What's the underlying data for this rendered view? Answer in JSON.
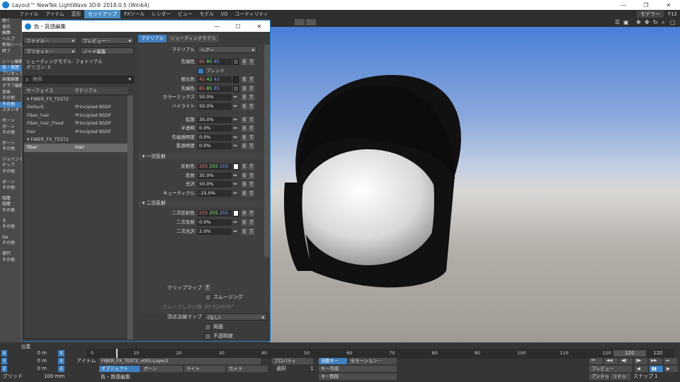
{
  "app": {
    "title": "Layout™ NewTek LightWave 3D® 2018.0.5 (Win64)",
    "win_min": "—",
    "win_max": "❐",
    "win_close": "✕"
  },
  "menu": {
    "tabs": [
      "ファイル",
      "アイテム",
      "変形",
      "セットアップ",
      "FXツール",
      "レンダー",
      "ビュー",
      "モデル",
      "I/O",
      "ユーティリティ"
    ],
    "active": "セットアップ",
    "modeler_btn": "モデラー",
    "f12": "F12"
  },
  "left_sidebar": [
    "開く",
    "保存",
    "編集",
    "ヘルプ",
    "新規シーン",
    "終了",
    "",
    "シーン編集",
    "色・質感",
    "プリセット",
    "画像編集",
    "グラフ編集",
    "背景",
    "その他",
    "その他",
    "スタジオ",
    "",
    "ボーン",
    "ボーン",
    "その他",
    "",
    "ボーン",
    "その他",
    "",
    "ジョイント",
    "チップ",
    "その他",
    "",
    "ボーン",
    "その他",
    "",
    "階層",
    "階層",
    "その他",
    "",
    "モ",
    "その他",
    "",
    "Ge",
    "その他",
    "",
    "遅代",
    "その他"
  ],
  "dialog": {
    "title": "色・質感編集",
    "min": "—",
    "max": "☐",
    "close": "✕",
    "file_dd": "ファイル···",
    "preview_dd": "プレビュー···",
    "preset_dd": "プリセット···",
    "node_btn": "ノード編集",
    "shading_model_label": "シェーディングモデル:",
    "shading_model_value": "フォトリアル",
    "polygon_label": "ポリゴン:",
    "polygon_value": "0",
    "search_placeholder": "検索",
    "col_surface": "サーフェイス",
    "col_material": "マテリアル",
    "rows": [
      {
        "surface": "▾ FIBER_FX_TEST2",
        "material": "",
        "sel": false
      },
      {
        "surface": "Default",
        "material": "Principled BSDF",
        "sel": false
      },
      {
        "surface": "Fiber_hair",
        "material": "Principled BSDF",
        "sel": false
      },
      {
        "surface": "Fiber_hair_Fixed",
        "material": "Principled BSDF",
        "sel": false
      },
      {
        "surface": "hair",
        "material": "Principled BSDF",
        "sel": false
      },
      {
        "surface": "▾ FIBER_FX_TEST2",
        "material": "",
        "sel": false
      },
      {
        "surface": "fiber",
        "material": "Hair",
        "sel": true
      }
    ],
    "tab_material": "マテリアル",
    "tab_shading": "シェーディングモデル",
    "material_label": "マテリアル",
    "material_value": "ヘアー",
    "tip_color": {
      "label": "先端色",
      "r": "85",
      "g": "85",
      "b": "85",
      "swatch": "#555555"
    },
    "blend_label": "ブレンド",
    "root_color": {
      "label": "根元色",
      "r": "42",
      "g": "42",
      "b": "42",
      "swatch": "#2a2a2a"
    },
    "tip_color2": {
      "label": "先端色",
      "r": "85",
      "g": "85",
      "b": "85",
      "swatch": "#555555"
    },
    "params1": [
      {
        "label": "カラーミックス",
        "value": "50.0%"
      },
      {
        "label": "ハイライト",
        "value": "50.0%"
      }
    ],
    "params2": [
      {
        "label": "拡散",
        "value": "35.0%"
      },
      {
        "label": "半透明",
        "value": "0.0%"
      },
      {
        "label": "先端透明度",
        "value": "0.0%"
      },
      {
        "label": "影透明度",
        "value": "0.0%"
      }
    ],
    "section_primary": "一次反射",
    "primary_color": {
      "label": "反射色",
      "r": "255",
      "g": "255",
      "b": "255",
      "swatch": "#ffffff"
    },
    "primary_params": [
      {
        "label": "反射",
        "value": "35.0%"
      },
      {
        "label": "光沢",
        "value": "50.0%"
      },
      {
        "label": "キューティクル",
        "value": "-15.0%"
      }
    ],
    "section_secondary": "二次反射",
    "secondary_color": {
      "label": "二次反射色",
      "r": "255",
      "g": "255",
      "b": "255",
      "swatch": "#ffffff"
    },
    "secondary_params": [
      {
        "label": "二次反射",
        "value": "0.0%"
      },
      {
        "label": "二次光沢",
        "value": "2.0%"
      }
    ],
    "clip_map_label": "クリップマップ",
    "clip_map_btn": "T",
    "smoothing_label": "スムージング",
    "smooth_threshold_label": "スムースしきい値",
    "smooth_threshold_value": "89.524655°",
    "vertex_normal_label": "頂点法線マップ",
    "vertex_normal_value": "(なし)",
    "double_sided_label": "両面",
    "opaque_label": "不透明度",
    "comment_label": "コメント",
    "e": "E",
    "t": "T",
    "env": "◆"
  },
  "timeline": {
    "pos_label": "位置",
    "ticks": [
      "0",
      "10",
      "20",
      "30",
      "40",
      "50",
      "60",
      "70",
      "80",
      "90",
      "100",
      "110",
      "120"
    ],
    "frame_current": "120",
    "frame_end": "120",
    "x": "X",
    "y": "Y",
    "z": "Z",
    "x_val": "0 m",
    "y_val": "0 m",
    "z_val": "0 m",
    "grid_label": "グリッド",
    "grid_value": "100 mm",
    "item_label": "アイテム",
    "item_value": "FIBER_FX_TEST2_v001:Layer2",
    "object_btn": "オブジェクト",
    "bone_btn": "ボーン",
    "light_btn": "ライト",
    "camera_btn": "カメラ",
    "prop_btn": "プロパティ",
    "select_label": "選択",
    "select_value": "1",
    "autokey_label": "自動キー",
    "autokey_value": "全モーション···",
    "create_key": "キー作成",
    "delete_key": "キー削除",
    "ret": "ret",
    "del": "del",
    "preview_dd": "プレビュー",
    "undo_btn": "アンドゥ",
    "redo_btn": "リドゥ",
    "snap_label": "スナップ",
    "snap_value": "1",
    "status": "色・質感編集"
  }
}
